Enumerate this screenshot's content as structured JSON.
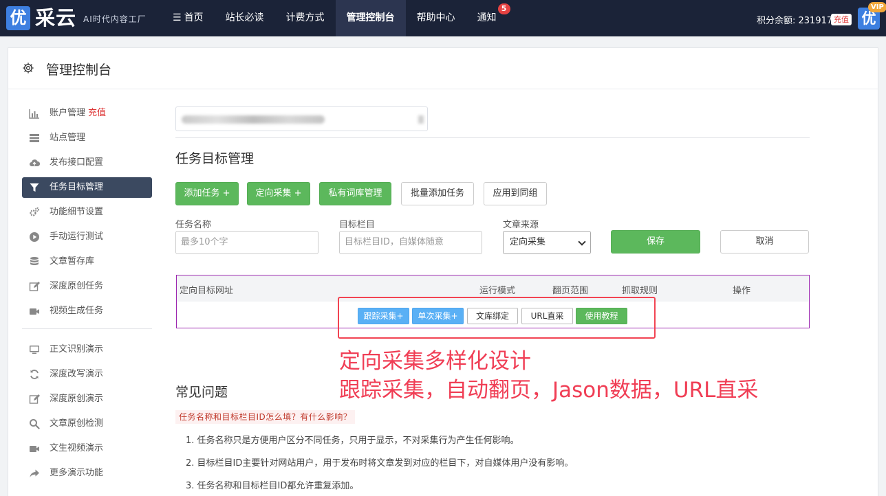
{
  "brand": {
    "logo_char": "优",
    "name": "采云",
    "slogan": "AI时代内容工厂"
  },
  "nav": {
    "items": [
      {
        "label": "首页"
      },
      {
        "label": "站长必读"
      },
      {
        "label": "计费方式"
      },
      {
        "label": "管理控制台"
      },
      {
        "label": "帮助中心"
      },
      {
        "label": "通知"
      }
    ],
    "notify_count": "5",
    "points_text": "积分余额: 2319178",
    "recharge_label": "充值",
    "vip_logo_char": "优",
    "vip_label": "VIP"
  },
  "page": {
    "title": "管理控制台"
  },
  "sidebar": {
    "items": [
      {
        "label": "账户管理",
        "extra": "充值",
        "icon": "bar-chart-icon"
      },
      {
        "label": "站点管理",
        "icon": "server-icon"
      },
      {
        "label": "发布接口配置",
        "icon": "cloud-upload-icon"
      },
      {
        "label": "任务目标管理",
        "icon": "filter-icon"
      },
      {
        "label": "功能细节设置",
        "icon": "gears-icon"
      },
      {
        "label": "手动运行测试",
        "icon": "play-icon"
      },
      {
        "label": "文章暂存库",
        "icon": "database-icon"
      },
      {
        "label": "深度原创任务",
        "icon": "edit-icon"
      },
      {
        "label": "视频生成任务",
        "icon": "video-icon"
      },
      {
        "label": "正文识别演示",
        "icon": "monitor-icon"
      },
      {
        "label": "深度改写演示",
        "icon": "refresh-icon"
      },
      {
        "label": "深度原创演示",
        "icon": "edit-icon"
      },
      {
        "label": "文章原创检测",
        "icon": "search-icon"
      },
      {
        "label": "文生视频演示",
        "icon": "video-icon"
      },
      {
        "label": "更多演示功能",
        "icon": "share-icon"
      }
    ]
  },
  "main": {
    "section_title": "任务目标管理",
    "buttons": {
      "add_task": "添加任务 +",
      "targeted": "定向采集 +",
      "private_lexicon": "私有词库管理",
      "batch_add": "批量添加任务",
      "apply_group": "应用到同组"
    },
    "form": {
      "task_name_label": "任务名称",
      "task_name_placeholder": "最多10个字",
      "column_label": "目标栏目",
      "column_placeholder": "目标栏目ID，自媒体随意",
      "source_label": "文章来源",
      "source_value": "定向采集",
      "save": "保存",
      "cancel": "取消"
    },
    "table": {
      "headers": [
        "定向目标网址",
        "运行模式",
        "翻页范围",
        "抓取规则",
        "操作"
      ],
      "actions": [
        "跟踪采集+",
        "单次采集+",
        "文库绑定",
        "URL直采",
        "使用教程"
      ]
    },
    "annotation": {
      "line1": "定向采集多样化设计",
      "line2": "跟踪采集，自动翻页，Jason数据，URL直采"
    },
    "faq": {
      "title": "常见问题",
      "question": "任务名称和目标栏目ID怎么填？有什么影响？",
      "answers": [
        "1. 任务名称只是方便用户区分不同任务，只用于显示，不对采集行为产生任何影响。",
        "2. 目标栏目ID主要针对网站用户，用于发布时将文章发到对应的栏目下，对自媒体用户没有影响。",
        "3. 任务名称和目标栏目ID都允许重复添加。"
      ]
    }
  }
}
